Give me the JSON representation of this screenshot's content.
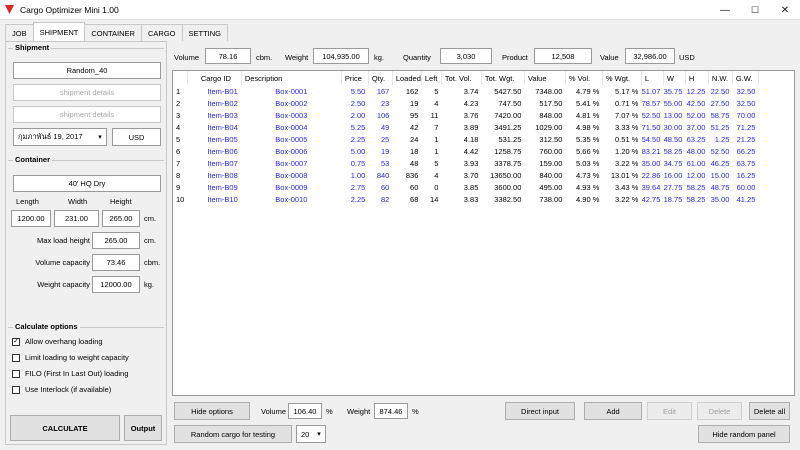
{
  "window": {
    "title": "Cargo Optimizer Mini 1.00",
    "minimize": "—",
    "maximize": "☐",
    "close": "✕"
  },
  "tabs": [
    "JOB",
    "SHIPMENT",
    "CONTAINER",
    "CARGO",
    "SETTING"
  ],
  "shipment": {
    "title": "Shipment",
    "name": "Random_40",
    "details1": "shipment details",
    "details2": "shipment details",
    "date": "กุมภาพันธ์ 19, 2017",
    "currency": "USD"
  },
  "container": {
    "title": "Container",
    "type": "40' HQ Dry",
    "length_label": "Length",
    "width_label": "Width",
    "height_label": "Height",
    "length": "1200.00",
    "width": "231.00",
    "height": "265.00",
    "dim_unit": "cm.",
    "max_load_label": "Max load height",
    "max_load": "265.00",
    "max_load_unit": "cm.",
    "volume_label": "Volume capacity",
    "volume": "73.46",
    "volume_unit": "cbm.",
    "weight_label": "Weight capacity",
    "weight": "12000.00",
    "weight_unit": "kg."
  },
  "options": {
    "title": "Calculate options",
    "items": [
      {
        "label": "Allow overhang loading",
        "checked": true
      },
      {
        "label": "Limit loading to weight capacity",
        "checked": false
      },
      {
        "label": "FILO (First In Last Out) loading",
        "checked": false
      },
      {
        "label": "Use Interlock (if available)",
        "checked": false
      }
    ]
  },
  "buttons": {
    "calculate": "CALCULATE",
    "output": "Output",
    "hide_options": "Hide options",
    "random_cargo": "Random cargo for testing",
    "random_count": "20",
    "direct_input": "Direct input",
    "add": "Add",
    "edit": "Edit",
    "delete": "Delete",
    "delete_all": "Delete all",
    "hide_random": "Hide random panel"
  },
  "summary": {
    "volume_label": "Volume",
    "volume": "78.16",
    "volume_unit": "cbm.",
    "weight_label": "Weight",
    "weight": "104,935.00",
    "weight_unit": "kg.",
    "quantity_label": "Quantity",
    "quantity": "3,030",
    "product_label": "Product",
    "product": "12,508",
    "value_label": "Value",
    "value": "32,986.00",
    "value_unit": "USD"
  },
  "footer": {
    "volume_label": "Volume",
    "volume": "106.40",
    "volume_unit": "%",
    "weight_label": "Weight",
    "weight": "874.46",
    "weight_unit": "%"
  },
  "table": {
    "columns": [
      "",
      "Cargo ID",
      "Description",
      "Price",
      "Qty.",
      "Loaded",
      "Left",
      "Tot. Vol.",
      "Tot. Wgt.",
      "Value",
      "% Vol.",
      "% Wgt.",
      "L",
      "W",
      "H",
      "N.W.",
      "G.W."
    ],
    "rows": [
      [
        "1",
        "Item-B01",
        "Box-0001",
        "5.50",
        "167",
        "162",
        "5",
        "3.74",
        "5427.50",
        "7348.00",
        "4.79 %",
        "5.17 %",
        "51.07",
        "35.75",
        "12.25",
        "22.50",
        "32.50"
      ],
      [
        "2",
        "Item-B02",
        "Box-0002",
        "2.50",
        "23",
        "19",
        "4",
        "4.23",
        "747.50",
        "517.50",
        "5.41 %",
        "0.71 %",
        "78.57",
        "55.00",
        "42.50",
        "27.50",
        "32.50"
      ],
      [
        "3",
        "Item-B03",
        "Box-0003",
        "2.00",
        "106",
        "95",
        "11",
        "3.76",
        "7420.00",
        "848.00",
        "4.81 %",
        "7.07 %",
        "52.50",
        "13.00",
        "52.00",
        "58.75",
        "70.00"
      ],
      [
        "4",
        "Item-B04",
        "Box-0004",
        "5.25",
        "49",
        "42",
        "7",
        "3.89",
        "3491.25",
        "1029.00",
        "4.98 %",
        "3.33 %",
        "71.50",
        "30.00",
        "37.00",
        "51.25",
        "71.25"
      ],
      [
        "5",
        "Item-B05",
        "Box-0005",
        "2.25",
        "25",
        "24",
        "1",
        "4.18",
        "531.25",
        "312.50",
        "5.35 %",
        "0.51 %",
        "54.50",
        "48.50",
        "63.25",
        "1.25",
        "21.25"
      ],
      [
        "6",
        "Item-B06",
        "Box-0006",
        "5.00",
        "19",
        "18",
        "1",
        "4.42",
        "1258.75",
        "760.00",
        "5.66 %",
        "1.20 %",
        "83.21",
        "58.25",
        "48.00",
        "52.50",
        "66.25"
      ],
      [
        "7",
        "Item-B07",
        "Box-0007",
        "0.75",
        "53",
        "48",
        "5",
        "3.93",
        "3378.75",
        "159.00",
        "5.03 %",
        "3.22 %",
        "35.00",
        "34.75",
        "61.00",
        "46.25",
        "63.75"
      ],
      [
        "8",
        "Item-B08",
        "Box-0008",
        "1.00",
        "840",
        "836",
        "4",
        "3.70",
        "13650.00",
        "840.00",
        "4.73 %",
        "13.01 %",
        "22.86",
        "16.00",
        "12.00",
        "15.00",
        "16.25"
      ],
      [
        "9",
        "Item-B09",
        "Box-0009",
        "2.75",
        "60",
        "60",
        "0",
        "3.85",
        "3600.00",
        "495.00",
        "4.93 %",
        "3.43 %",
        "39.64",
        "27.75",
        "58.25",
        "48.75",
        "60.00"
      ],
      [
        "10",
        "Item-B10",
        "Box-0010",
        "2.25",
        "82",
        "68",
        "14",
        "3.83",
        "3382.50",
        "738.00",
        "4.90 %",
        "3.22 %",
        "42.75",
        "18.75",
        "58.25",
        "35.00",
        "41.25"
      ]
    ]
  }
}
